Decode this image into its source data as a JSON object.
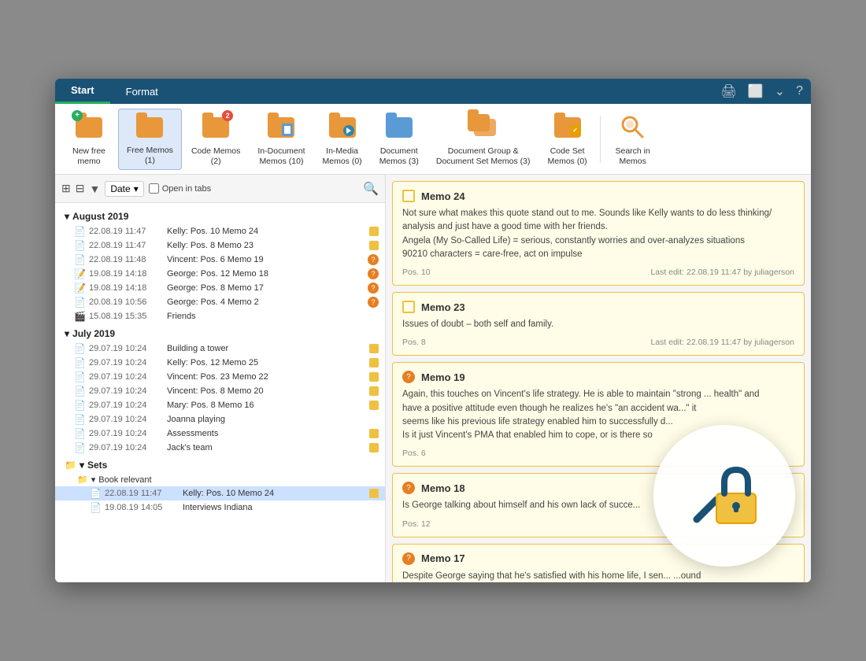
{
  "window": {
    "title": "Free Memos"
  },
  "titleBar": {
    "tabs": [
      {
        "id": "start",
        "label": "Start",
        "active": true
      },
      {
        "id": "format",
        "label": "Format",
        "active": false
      }
    ],
    "icons": [
      "print",
      "export",
      "chevron-down",
      "help"
    ]
  },
  "ribbon": {
    "items": [
      {
        "id": "new-free-memo",
        "label": "New free\nmemo",
        "icon": "folder-plus-orange",
        "badge": "+"
      },
      {
        "id": "free-memos",
        "label": "Free Memos\n(1)",
        "icon": "folder-orange",
        "active": true
      },
      {
        "id": "code-memos",
        "label": "Code Memos\n(2)",
        "icon": "folder-orange-badge",
        "badge": "2"
      },
      {
        "id": "in-document-memos",
        "label": "In-Document\nMemos (10)",
        "icon": "folder-blue-doc"
      },
      {
        "id": "in-media-memos",
        "label": "In-Media\nMemos (0)",
        "icon": "folder-teal-media"
      },
      {
        "id": "document-memos",
        "label": "Document\nMemos (3)",
        "icon": "folder-blue"
      },
      {
        "id": "doc-group-memos",
        "label": "Document Group &\nDocument Set Memos (3)",
        "icon": "folder-orange-multi"
      },
      {
        "id": "code-set-memos",
        "label": "Code Set\nMemos (0)",
        "icon": "folder-orange-set"
      },
      {
        "id": "search-in-memos",
        "label": "Search in\nMemos",
        "icon": "search-magnify"
      }
    ]
  },
  "toolbar": {
    "sortLabel": "Date",
    "openInTabsLabel": "Open in tabs"
  },
  "tree": {
    "groups": [
      {
        "id": "august-2019",
        "label": "August 2019",
        "expanded": true,
        "items": [
          {
            "id": "m24",
            "date": "22.08.19",
            "time": "11:47",
            "text": "Kelly: Pos. 10  Memo 24",
            "badge": "plain",
            "docType": "doc"
          },
          {
            "id": "m23",
            "date": "22.08.19",
            "time": "11:47",
            "text": "Kelly: Pos. 8   Memo 23",
            "badge": "plain",
            "docType": "doc"
          },
          {
            "id": "m19",
            "date": "22.08.19",
            "time": "11:48",
            "text": "Vincent: Pos. 6  Memo 19",
            "badge": "question",
            "docType": "doc"
          },
          {
            "id": "m18",
            "date": "19.08.19",
            "time": "14:18",
            "text": "George: Pos. 12  Memo 18",
            "badge": "question",
            "docType": "doc-edit"
          },
          {
            "id": "m17",
            "date": "19.08.19",
            "time": "14:18",
            "text": "George: Pos. 8   Memo 17",
            "badge": "question",
            "docType": "doc-edit"
          },
          {
            "id": "m2",
            "date": "20.08.19",
            "time": "10:56",
            "text": "George: Pos. 4   Memo 2",
            "badge": "question",
            "docType": "doc"
          },
          {
            "id": "friends",
            "date": "15.08.19",
            "time": "15:35",
            "text": "Friends",
            "badge": "none",
            "docType": "media"
          }
        ]
      },
      {
        "id": "july-2019",
        "label": "July 2019",
        "expanded": true,
        "items": [
          {
            "id": "tower",
            "date": "29.07.19",
            "time": "10:24",
            "text": "Building a tower",
            "badge": "plain",
            "docType": "doc"
          },
          {
            "id": "m25",
            "date": "29.07.19",
            "time": "10:24",
            "text": "Kelly: Pos. 12  Memo 25",
            "badge": "plain",
            "docType": "doc"
          },
          {
            "id": "m22",
            "date": "29.07.19",
            "time": "10:24",
            "text": "Vincent: Pos. 23  Memo 22",
            "badge": "plain",
            "docType": "doc"
          },
          {
            "id": "m20",
            "date": "29.07.19",
            "time": "10:24",
            "text": "Vincent: Pos. 8   Memo 20",
            "badge": "plain",
            "docType": "doc"
          },
          {
            "id": "m16",
            "date": "29.07.19",
            "time": "10:24",
            "text": "Mary: Pos. 8   Memo 16",
            "badge": "plain",
            "docType": "doc"
          },
          {
            "id": "joanna",
            "date": "29.07.19",
            "time": "10:24",
            "text": "Joanna playing",
            "badge": "none",
            "docType": "doc"
          },
          {
            "id": "assess",
            "date": "29.07.19",
            "time": "10:24",
            "text": "Assessments",
            "badge": "plain",
            "docType": "doc"
          },
          {
            "id": "jack",
            "date": "29.07.19",
            "time": "10:24",
            "text": "Jack's team",
            "badge": "plain",
            "docType": "doc"
          }
        ]
      }
    ],
    "sets": {
      "label": "Sets",
      "expanded": true,
      "children": [
        {
          "label": "Book relevant",
          "expanded": true,
          "items": [
            {
              "id": "sets-m24",
              "date": "22.08.19",
              "time": "11:47",
              "text": "Kelly: Pos. 10  Memo 24",
              "badge": "plain",
              "selected": true
            },
            {
              "id": "sets-indiana",
              "date": "19.08.19",
              "time": "14:05",
              "text": "Interviews Indiana",
              "badge": "none"
            }
          ]
        }
      ]
    }
  },
  "memoCards": [
    {
      "id": "memo24",
      "title": "Memo 24",
      "icon": "plain",
      "body": "Not sure what makes this quote stand out to me. Sounds like Kelly wants to do less thinking/\nanalysis and just have a good time with her friends.\nAngela (My So-Called Life) = serious, constantly worries and over-analyzes situations\n90210 characters = care-free, act on impulse",
      "pos": "Pos. 10",
      "lastEdit": "Last edit: 22.08.19  11:47  by juliagerson"
    },
    {
      "id": "memo23",
      "title": "Memo 23",
      "icon": "plain",
      "body": "Issues of doubt – both self and family.",
      "pos": "Pos. 8",
      "lastEdit": "Last edit: 22.08.19  11:47  by juliagerson"
    },
    {
      "id": "memo19",
      "title": "Memo 19",
      "icon": "question",
      "body": "Again, this touches on Vincent's life strategy. He is able to maintain \"strong ... health\" and\nhave a positive attitude even though he realizes he's \"an accident wa...\" it\nseems like his previous life strategy enabled him to successfully d...\nIs it just Vincent's PMA that enabled him to cope, or is there so",
      "pos": "Pos. 6",
      "lastEdit": ""
    },
    {
      "id": "memo18",
      "title": "Memo 18",
      "icon": "question",
      "body": "Is George talking about himself and his own lack of succe...",
      "pos": "Pos. 12",
      "lastEdit": ""
    },
    {
      "id": "memo17",
      "title": "Memo 17",
      "icon": "question",
      "body": "Despite George saying that he's satisfied with his home life, I sen... ...ound",
      "pos": "",
      "lastEdit": ""
    }
  ],
  "overlay": {
    "visible": true,
    "icon": "lock-search"
  }
}
